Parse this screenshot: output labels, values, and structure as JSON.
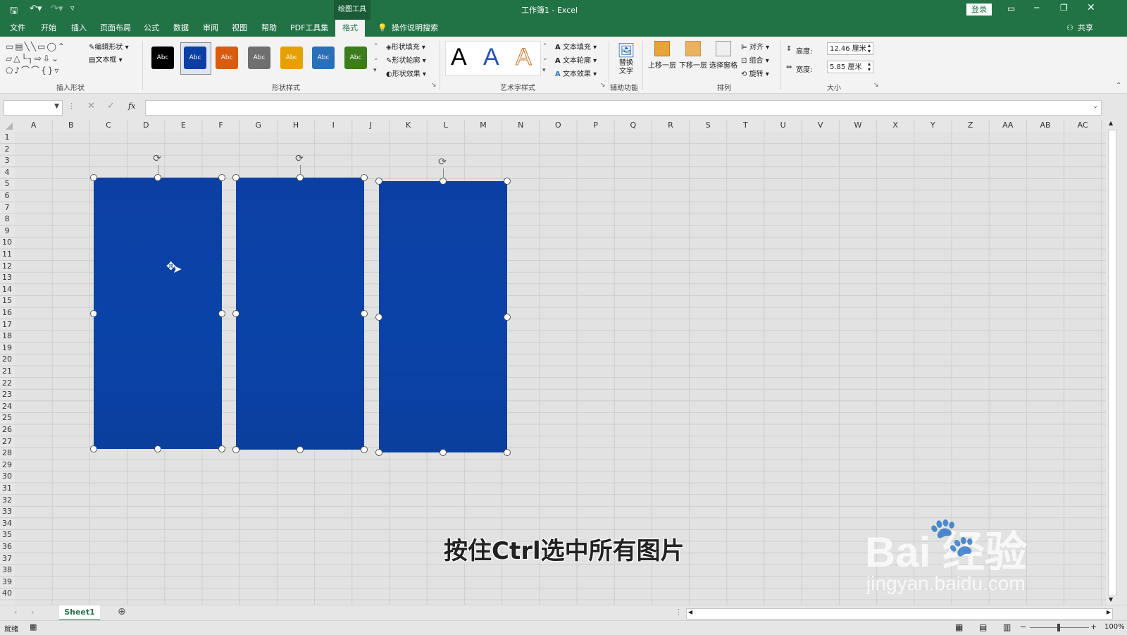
{
  "titlebar": {
    "title": "工作簿1  -  Excel",
    "context_tab": "绘图工具",
    "login": "登录"
  },
  "tabs": [
    "文件",
    "开始",
    "插入",
    "页面布局",
    "公式",
    "数据",
    "审阅",
    "视图",
    "帮助",
    "PDF工具集",
    "格式"
  ],
  "tell_me": "操作说明搜索",
  "share": "共享",
  "ribbon": {
    "insert_shapes": {
      "label": "插入形状",
      "edit_shape": "编辑形状",
      "textbox": "文本框"
    },
    "shape_styles": {
      "label": "形状样式",
      "swatch_text": "Abc",
      "fill": "形状填充",
      "outline": "形状轮廓",
      "effects": "形状效果",
      "swatch_colors": [
        "#000000",
        "#0c3fa3",
        "#d85b10",
        "#6f6f6f",
        "#e6a000",
        "#2a6fb8",
        "#3a7d1a"
      ]
    },
    "wordart_styles": {
      "label": "艺术字样式",
      "letter": "A",
      "text_fill": "文本填充",
      "text_outline": "文本轮廓",
      "text_effects": "文本效果"
    },
    "accessibility": {
      "label": "辅助功能",
      "alt_text": "替换文字"
    },
    "arrange": {
      "label": "排列",
      "bring_forward": "上移一层",
      "send_backward": "下移一层",
      "selection_pane": "选择窗格",
      "align": "对齐",
      "group": "组合",
      "rotate": "旋转"
    },
    "size": {
      "label": "大小",
      "height_label": "高度:",
      "height_value": "12.46 厘米",
      "width_label": "宽度:",
      "width_value": "5.85 厘米"
    }
  },
  "formula": {
    "fx": "fx"
  },
  "columns": [
    "A",
    "B",
    "C",
    "D",
    "E",
    "F",
    "G",
    "H",
    "I",
    "J",
    "K",
    "L",
    "M",
    "N",
    "O",
    "P",
    "Q",
    "R",
    "S",
    "T",
    "U",
    "V",
    "W",
    "X",
    "Y",
    "Z",
    "AA",
    "AB",
    "AC"
  ],
  "rows": [
    "1",
    "2",
    "3",
    "4",
    "5",
    "6",
    "7",
    "8",
    "9",
    "10",
    "11",
    "12",
    "13",
    "14",
    "15",
    "16",
    "17",
    "18",
    "19",
    "20",
    "21",
    "22",
    "23",
    "24",
    "25",
    "26",
    "27",
    "28",
    "29",
    "30",
    "31",
    "32",
    "33",
    "34",
    "35",
    "36",
    "37",
    "38",
    "39",
    "40"
  ],
  "sheet_tab": "Sheet1",
  "status": {
    "ready": "就绪",
    "zoom": "100%"
  },
  "caption": "按住Ctrl选中所有图片",
  "watermark": {
    "brand": "Bai  经验",
    "url": "jingyan.baidu.com"
  }
}
